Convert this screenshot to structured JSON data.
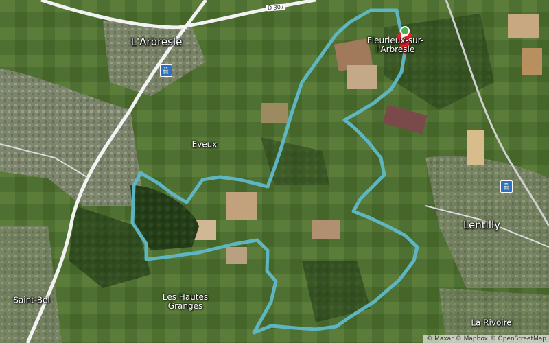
{
  "places": {
    "arbresle": "L'Arbresle",
    "fleurieux_line1": "Fleurieux-sur-",
    "fleurieux_line2": "l'Arbresle",
    "eveux": "Eveux",
    "lentilly": "Lentilly",
    "saint_bel": "Saint-Bel",
    "hautes_granges_line1": "Les Hautes",
    "hautes_granges_line2": "Granges",
    "la_rivoire": "La Rivoire"
  },
  "road_label": "D 307",
  "station_icon_glyph": "🚆",
  "attribution": "© Maxar © Mapbox © OpenStreetMap",
  "route_color": "#5fb9c9",
  "marker_color": "#e8202a"
}
